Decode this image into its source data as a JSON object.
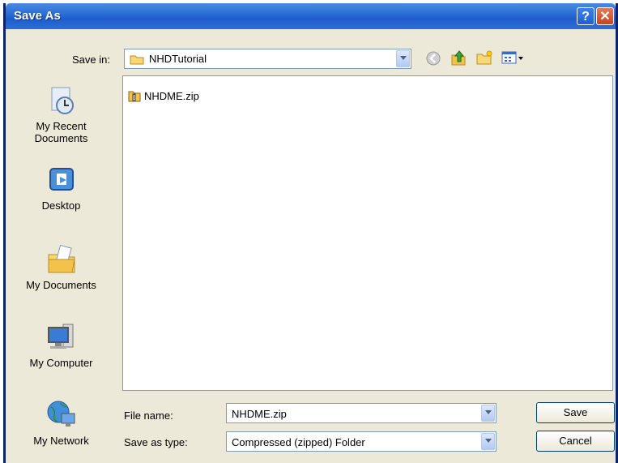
{
  "window": {
    "title": "Save As",
    "help_glyph": "?",
    "close_glyph": "✕"
  },
  "toolbar": {
    "save_in_label": "Save in:",
    "save_in_value": "NHDTutorial",
    "icons": [
      "back-icon",
      "up-folder-icon",
      "new-folder-icon",
      "views-menu-icon"
    ]
  },
  "places": [
    {
      "label_lines": [
        "My Recent",
        "Documents"
      ],
      "icon": "recent-documents-icon"
    },
    {
      "label_lines": [
        "Desktop"
      ],
      "icon": "desktop-icon"
    },
    {
      "label_lines": [
        "My Documents"
      ],
      "icon": "my-documents-icon"
    },
    {
      "label_lines": [
        "My Computer"
      ],
      "icon": "my-computer-icon"
    },
    {
      "label_lines": [
        "My Network"
      ],
      "icon": "my-network-icon"
    }
  ],
  "files": [
    {
      "name": "NHDME.zip",
      "icon": "zip-file-icon"
    }
  ],
  "bottom": {
    "file_name_label": "File name:",
    "file_name_value": "NHDME.zip",
    "save_type_label": "Save as type:",
    "save_type_value": "Compressed (zipped) Folder",
    "save_button": "Save",
    "cancel_button": "Cancel"
  },
  "colors": {
    "dialog_bg": "#ECE9D8",
    "title_bar": "#1e5ccc",
    "border": "#7F9DB9"
  }
}
